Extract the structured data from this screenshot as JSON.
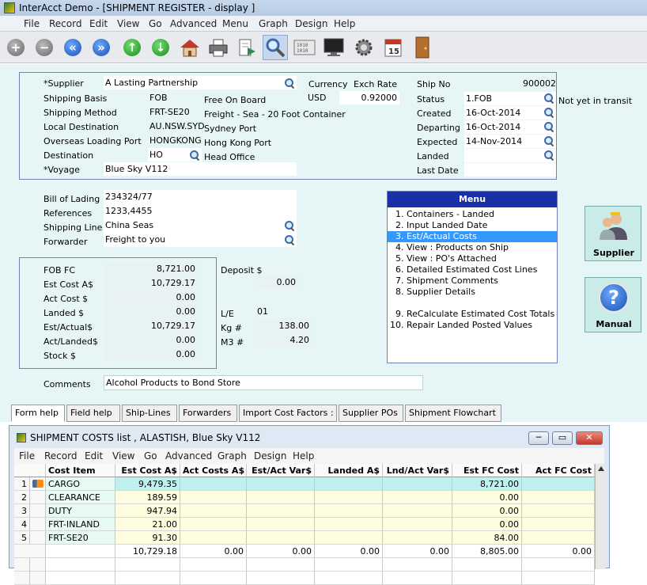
{
  "app": {
    "title": "InterAcct Demo - [SHIPMENT REGISTER - display ]",
    "menu": [
      "File",
      "Record",
      "Edit",
      "View",
      "Go",
      "Advanced",
      "Menu",
      "Graph",
      "Design",
      "Help"
    ]
  },
  "toolbar": {
    "icons": [
      "add-icon",
      "remove-icon",
      "previous-icon",
      "next-icon",
      "up-icon",
      "down-icon",
      "home-icon",
      "print-icon",
      "export-icon",
      "search-icon",
      "binary-icon",
      "monitor-icon",
      "settings-icon",
      "calendar-icon",
      "exit-door-icon"
    ],
    "calendar_day": "15",
    "binary_text": "1010"
  },
  "header": {
    "supplier_label": "*Supplier",
    "supplier": "A Lasting Partnership",
    "shipping_basis_label": "Shipping Basis",
    "shipping_basis_code": "FOB",
    "shipping_basis_desc": "Free On Board",
    "shipping_method_label": "Shipping Method",
    "shipping_method_code": "FRT-SE20",
    "shipping_method_desc": "Freight - Sea - 20 Foot Container",
    "local_destination_label": "Local Destination",
    "local_destination_code": "AU.NSW.SYD",
    "local_destination_desc": "Sydney Port",
    "overseas_port_label": "Overseas Loading Port",
    "overseas_port_code": "HONGKONG",
    "overseas_port_desc": "Hong Kong Port",
    "destination_label": "Destination",
    "destination_code": "HO",
    "destination_desc": "Head Office",
    "voyage_label": "*Voyage",
    "voyage": "Blue Sky V112",
    "currency_label": "Currency",
    "currency": "USD",
    "exch_rate_label": "Exch Rate",
    "exch_rate": "0.92000",
    "ship_no_label": "Ship No",
    "ship_no": "900002",
    "status_label": "Status",
    "status": "1.FOB",
    "status_desc": "Not yet in transit",
    "created_label": "Created",
    "created": "16-Oct-2014",
    "departing_label": "Departing",
    "departing": "16-Oct-2014",
    "expected_label": "Expected",
    "expected": "14-Nov-2014",
    "landed_label": "Landed",
    "landed": "",
    "last_date_label": "Last Date",
    "last_date": ""
  },
  "lading": {
    "bill_label": "Bill of Lading",
    "bill": "234324/77",
    "references_label": "References",
    "references": "1233,4455",
    "shipping_line_label": "Shipping Line",
    "shipping_line": "China Seas",
    "forwarder_label": "Forwarder",
    "forwarder": "Freight to you"
  },
  "costs": {
    "fob_fc_label": "FOB FC",
    "fob_fc": "8,721.00",
    "est_cost_label": "Est Cost A$",
    "est_cost": "10,729.17",
    "act_cost_label": "Act Cost $",
    "act_cost": "0.00",
    "landed_label": "Landed $",
    "landed": "0.00",
    "est_actual_label": "Est/Actual$",
    "est_actual": "10,729.17",
    "act_landed_label": "Act/Landed$",
    "act_landed": "0.00",
    "stock_label": "Stock $",
    "stock": "0.00",
    "deposit_label": "Deposit $",
    "deposit": "0.00",
    "le_label": "L/E",
    "le": "01",
    "kg_label": "Kg #",
    "kg": "138.00",
    "m3_label": "M3 #",
    "m3": "4.20"
  },
  "menu_panel": {
    "header": "Menu",
    "items": [
      "1. Containers - Landed",
      "2. Input Landed Date",
      "3. Est/Actual Costs",
      "4. View : Products on Ship",
      "5. View : PO's Attached",
      "6. Detailed Estimated Cost Lines",
      "7. Shipment Comments",
      "8. Supplier Details",
      "9. ReCalculate Estimated Cost Totals",
      "10. Repair Landed Posted Values"
    ],
    "selected_index": 2
  },
  "side_buttons": {
    "supplier": "Supplier",
    "manual": "Manual",
    "manual_glyph": "?"
  },
  "comments_label": "Comments",
  "comments": "Alcohol Products to Bond Store",
  "tabs": [
    "Form help",
    "Field help",
    "Ship-Lines",
    "Forwarders",
    "Import Cost Factors :",
    "Supplier POs",
    "Shipment Flowchart"
  ],
  "cost_window": {
    "title": "SHIPMENT COSTS list , ALASTISH, Blue Sky V112",
    "menu": [
      "File",
      "Record",
      "Edit",
      "View",
      "Go",
      "Advanced",
      "Graph",
      "Design",
      "Help"
    ],
    "buttons": {
      "minimize": "─",
      "maximize": "▭",
      "close": "✕"
    },
    "columns": [
      "Cost Item",
      "Est Cost A$",
      "Act Costs A$",
      "Est/Act Var$",
      "Landed  A$",
      "Lnd/Act Var$",
      "Est FC Cost",
      "Act FC Cost"
    ],
    "rows": [
      {
        "n": "1",
        "item": "CARGO",
        "est": "9,479.35",
        "fc": "8,721.00"
      },
      {
        "n": "2",
        "item": "CLEARANCE",
        "est": "189.59",
        "fc": "0.00"
      },
      {
        "n": "3",
        "item": "DUTY",
        "est": "947.94",
        "fc": "0.00"
      },
      {
        "n": "4",
        "item": "FRT-INLAND",
        "est": "21.00",
        "fc": "0.00"
      },
      {
        "n": "5",
        "item": "FRT-SE20",
        "est": "91.30",
        "fc": "84.00"
      }
    ],
    "totals": [
      "10,729.18",
      "0.00",
      "0.00",
      "0.00",
      "0.00",
      "8,805.00",
      "0.00"
    ],
    "colors": {
      "row_bg": "#fffde0",
      "item_bg": "#e6f9f2",
      "selected_row": "#bff1ee"
    }
  }
}
